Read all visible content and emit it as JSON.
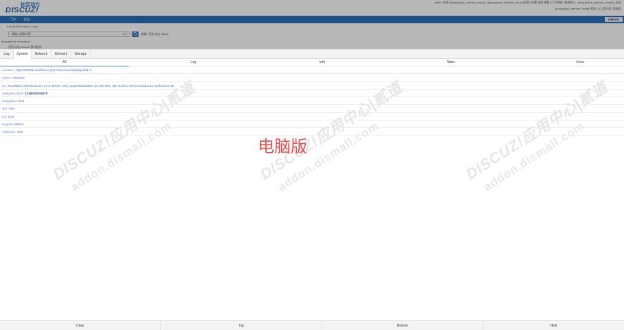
{
  "header": {
    "logo_cn": "社区动力",
    "logo_en": "DISCUZ!",
    "top_links": "admin 在线 | {lang global_usernav_extra1} | {lang global_usernav_extra4}设置 | 设置 消息 提醒 | 门户管理 | 管理中心 | {lang global_usernav_extra3} | 退出",
    "top_links2": "{lang global_usernav_extra5} 积分: 20 | 用户组: 管理员"
  },
  "nav": {
    "items": [
      "门户",
      "论坛"
    ],
    "right_button": "快捷导航"
  },
  "subpath": "{url admin/forum/c:n_nav}",
  "search": {
    "placeholder": "请输入搜索内容",
    "select": "帖子",
    "hot_label": "热搜: 活动 交友 discuz"
  },
  "global_tag": "{lang global_hotsearch}",
  "bg_tabs": "首页  论坛  Discuz!  默认版块",
  "console": {
    "tabs": [
      "Log",
      "System",
      "Network",
      "Element",
      "Storage"
    ],
    "active_tab": "System",
    "filters": [
      "All",
      "Log",
      "Info",
      "Warn",
      "Error"
    ],
    "rows": [
      {
        "label": "Location:",
        "value": "http://dz3taft.com/forum.php?mod=forumdisplay&fid=2"
      },
      {
        "label": "Client:",
        "value": "Unknown"
      },
      {
        "label": "UA:",
        "value": "Mozilla/5.0 (Windows NT 10.0; Win64; x64) AppleWebKit/537.36 (KHTML, like Gecko) Chrome/135.0.0.0 Safari/537.36"
      },
      {
        "label": "navigationStart:",
        "value": "1745033016270"
      },
      {
        "label": "navigation:",
        "value": "6ms"
      },
      {
        "label": "dns:",
        "value": "0ms"
      },
      {
        "label": "tcp:",
        "value": "0ms"
      },
      {
        "label": "request:",
        "value": "288ms"
      },
      {
        "label": "response:",
        "value": "4ms"
      }
    ],
    "bottom_buttons": [
      "Clear",
      "Top",
      "Bottom",
      "Hide"
    ]
  },
  "watermark": {
    "line1": "DISCUZ!应用中心|贰道",
    "line2": "addon.dismall.com"
  },
  "center_label": "电脑版"
}
